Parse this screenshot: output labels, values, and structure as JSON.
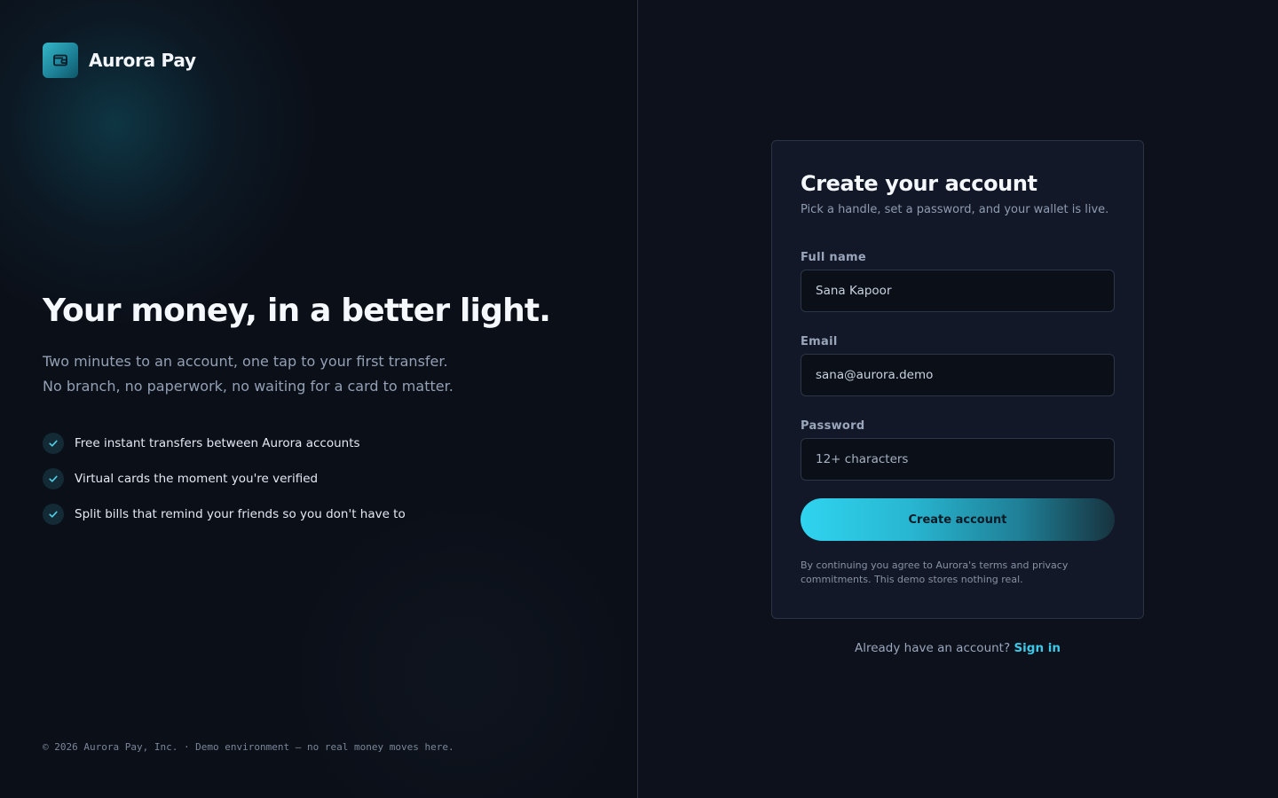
{
  "brand": {
    "name": "Aurora Pay",
    "icon": "wallet-icon"
  },
  "hero": {
    "title": "Your money, in a better light.",
    "subtitle_line1": "Two minutes to an account, one tap to your first transfer.",
    "subtitle_line2": "No branch, no paperwork, no waiting for a card to matter."
  },
  "features": [
    {
      "icon": "check-icon",
      "text": "Free instant transfers between Aurora accounts"
    },
    {
      "icon": "check-icon",
      "text": "Virtual cards the moment you're verified"
    },
    {
      "icon": "check-icon",
      "text": "Split bills that remind your friends so you don't have to"
    }
  ],
  "footer": {
    "note": "© 2026 Aurora Pay, Inc. · Demo environment — no real money moves here."
  },
  "form": {
    "title": "Create your account",
    "subtitle": "Pick a handle, set a password, and your wallet is live.",
    "full_name": {
      "label": "Full name",
      "value": "Sana Kapoor"
    },
    "email": {
      "label": "Email",
      "value": "sana@aurora.demo"
    },
    "password": {
      "label": "Password",
      "placeholder": "12+ characters"
    },
    "submit_label": "Create account",
    "legal": "By continuing you agree to Aurora's terms and privacy commitments. This demo stores nothing real."
  },
  "signin": {
    "prompt": "Already have an account?",
    "link_label": "Sign in"
  },
  "colors": {
    "accent": "#3cc9e8",
    "background": "#0b0f18",
    "card": "#121827"
  }
}
